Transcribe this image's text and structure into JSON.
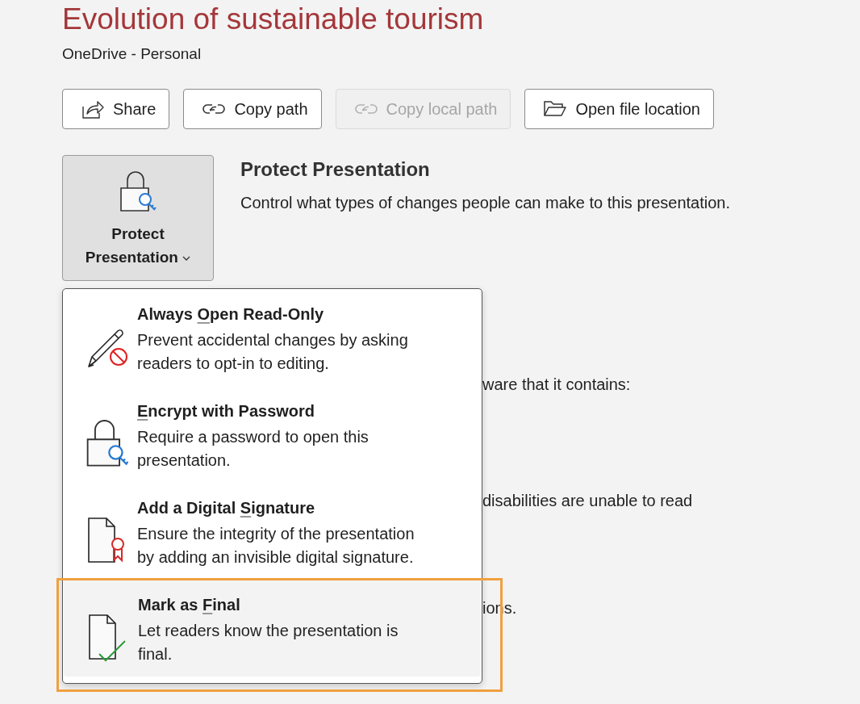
{
  "document": {
    "title": "Evolution of sustainable tourism",
    "location": "OneDrive - Personal"
  },
  "actions": [
    {
      "label": "Share",
      "disabled": false
    },
    {
      "label": "Copy path",
      "disabled": false
    },
    {
      "label": "Copy local path",
      "disabled": true
    },
    {
      "label": "Open file location",
      "disabled": false
    }
  ],
  "protect": {
    "button_label": "Protect Presentation",
    "expanded": true,
    "heading": "Protect Presentation",
    "description": "Control what types of changes people can make to this presentation."
  },
  "covered_texts": [
    "ware that it contains:",
    "disabilities are unable to read",
    "ions."
  ],
  "menu": {
    "items": [
      {
        "title_parts": {
          "before": "Always ",
          "key": "O",
          "after": "pen Read-Only"
        },
        "description": "Prevent accidental changes by asking readers to opt-in to editing.",
        "hovered": false,
        "annotated": false
      },
      {
        "title_parts": {
          "key": "E",
          "after": "ncrypt with Password"
        },
        "description": "Require a password to open this presentation.",
        "hovered": false,
        "annotated": false
      },
      {
        "title_parts": {
          "before": "Add a Digital ",
          "key": "S",
          "after": "ignature"
        },
        "description": "Ensure the integrity of the presentation by adding an invisible digital signature.",
        "hovered": false,
        "annotated": false
      },
      {
        "title_parts": {
          "before": "Mark as ",
          "key": "F",
          "after": "inal"
        },
        "description": "Let readers know the presentation is final.",
        "hovered": true,
        "annotated": true
      }
    ]
  }
}
